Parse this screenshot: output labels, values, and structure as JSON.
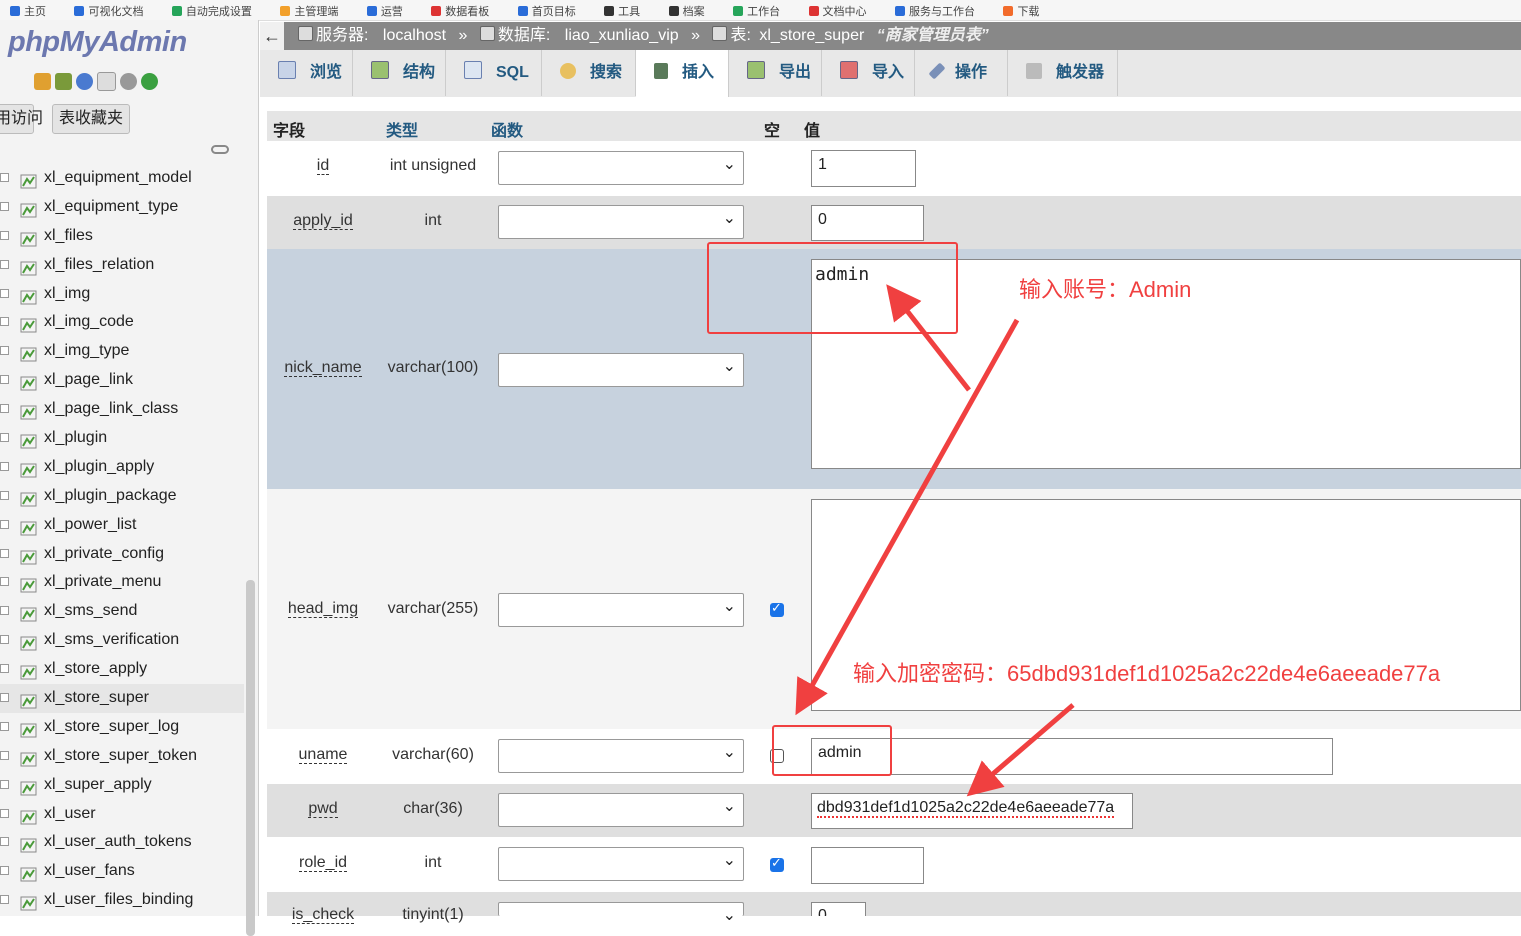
{
  "bookmarks": [
    "主页",
    "可视化文档",
    "自动完成设置",
    "主管理端",
    "运营",
    "数据看板",
    "首页目标",
    "工具",
    "档案",
    "工作台",
    "文档中心",
    "服务与工作台",
    "下载"
  ],
  "logo": {
    "part1": "php",
    "part2": "MyAdmin"
  },
  "sidebar": {
    "tabs": [
      "用访问",
      "表收藏夹"
    ],
    "tables": [
      "xl_equipment_model",
      "xl_equipment_type",
      "xl_files",
      "xl_files_relation",
      "xl_img",
      "xl_img_code",
      "xl_img_type",
      "xl_page_link",
      "xl_page_link_class",
      "xl_plugin",
      "xl_plugin_apply",
      "xl_plugin_package",
      "xl_power_list",
      "xl_private_config",
      "xl_private_menu",
      "xl_sms_send",
      "xl_sms_verification",
      "xl_store_apply",
      "xl_store_super",
      "xl_store_super_log",
      "xl_store_super_token",
      "xl_super_apply",
      "xl_user",
      "xl_user_auth_tokens",
      "xl_user_fans",
      "xl_user_files_binding"
    ],
    "active_table": "xl_store_super"
  },
  "breadcrumb": {
    "back": "←",
    "server_label": "服务器:",
    "server": "localhost",
    "db_label": "数据库:",
    "db": "liao_xunliao_vip",
    "table_label": "表:",
    "table": "xl_store_super",
    "comment": "“商家管理员表”",
    "separator": "»"
  },
  "menu": {
    "tabs": [
      "浏览",
      "结构",
      "SQL",
      "搜索",
      "插入",
      "导出",
      "导入",
      "操作",
      "触发器"
    ],
    "active": "插入"
  },
  "columns_header": {
    "field": "字段",
    "type": "类型",
    "function": "函数",
    "null": "空",
    "value": "值"
  },
  "rows": [
    {
      "field": "id",
      "type": "int unsigned",
      "null_shown": false,
      "value": "1"
    },
    {
      "field": "apply_id",
      "type": "int",
      "null_shown": false,
      "value": "0"
    },
    {
      "field": "nick_name",
      "type": "varchar(100)",
      "null_shown": false,
      "value": "admin"
    },
    {
      "field": "head_img",
      "type": "varchar(255)",
      "null_shown": true,
      "null_checked": true,
      "value": ""
    },
    {
      "field": "uname",
      "type": "varchar(60)",
      "null_shown": true,
      "null_checked": false,
      "value": "admin"
    },
    {
      "field": "pwd",
      "type": "char(36)",
      "null_shown": false,
      "value": "dbd931def1d1025a2c22de4e6aeeade77a"
    },
    {
      "field": "role_id",
      "type": "int",
      "null_shown": true,
      "null_checked": true,
      "value": ""
    },
    {
      "field": "is_check",
      "type": "tinyint(1)",
      "null_shown": false,
      "value": "0"
    }
  ],
  "annotations": {
    "account": "输入账号：Admin",
    "password": "输入加密密码：65dbd931def1d1025a2c22de4e6aeeade77a"
  },
  "colors": {
    "annotation": "#f04040",
    "checkbox": "#1a73e8",
    "tab_text": "#235a81",
    "breadcrumb_bg": "#888888",
    "selected_row": "#c7d2de"
  }
}
